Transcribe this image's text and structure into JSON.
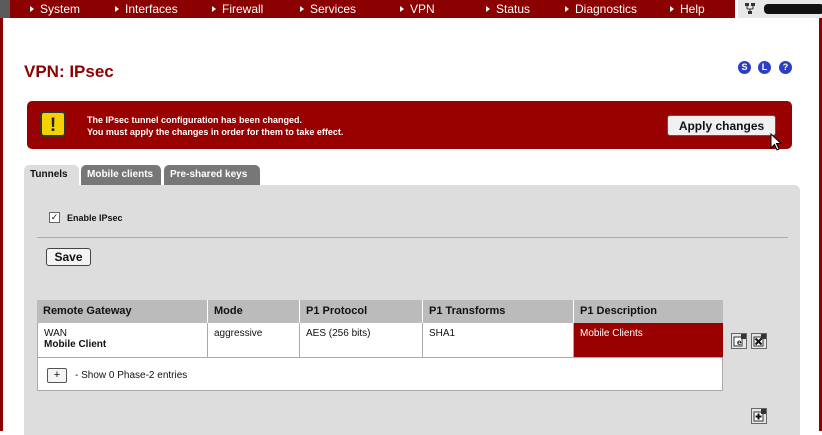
{
  "topnav": {
    "items": [
      {
        "label": "System"
      },
      {
        "label": "Interfaces"
      },
      {
        "label": "Firewall"
      },
      {
        "label": "Services"
      },
      {
        "label": "VPN"
      },
      {
        "label": "Status"
      },
      {
        "label": "Diagnostics"
      },
      {
        "label": "Help"
      }
    ]
  },
  "header": {
    "title": "VPN: IPsec",
    "icons": [
      "S",
      "L",
      "?"
    ]
  },
  "alert": {
    "line1": "The IPsec tunnel configuration has been changed.",
    "line2": "You must apply the changes in order for them to take effect.",
    "apply_label": "Apply changes",
    "icon_glyph": "!"
  },
  "tabs": [
    {
      "label": "Tunnels",
      "active": true
    },
    {
      "label": "Mobile clients",
      "active": false
    },
    {
      "label": "Pre-shared keys",
      "active": false
    }
  ],
  "settings": {
    "enable_label": "Enable IPsec",
    "enable_checked": true,
    "save_label": "Save"
  },
  "table": {
    "headers": [
      "Remote Gateway",
      "Mode",
      "P1 Protocol",
      "P1 Transforms",
      "P1 Description"
    ],
    "rows": [
      {
        "remote_gateway": "WAN",
        "remote_gateway_name": "Mobile Client",
        "mode": "aggressive",
        "p1_protocol": "AES (256 bits)",
        "p1_transforms": "SHA1",
        "p1_description": "Mobile Clients",
        "phase2_toggle": "+",
        "phase2_text": "- Show 0 Phase-2 entries"
      }
    ]
  },
  "colors": {
    "brand": "#8b0000",
    "alert": "#990000",
    "panel": "#dddddd",
    "header_row": "#bbbbbb",
    "help_icons": "#2b3fc4"
  }
}
